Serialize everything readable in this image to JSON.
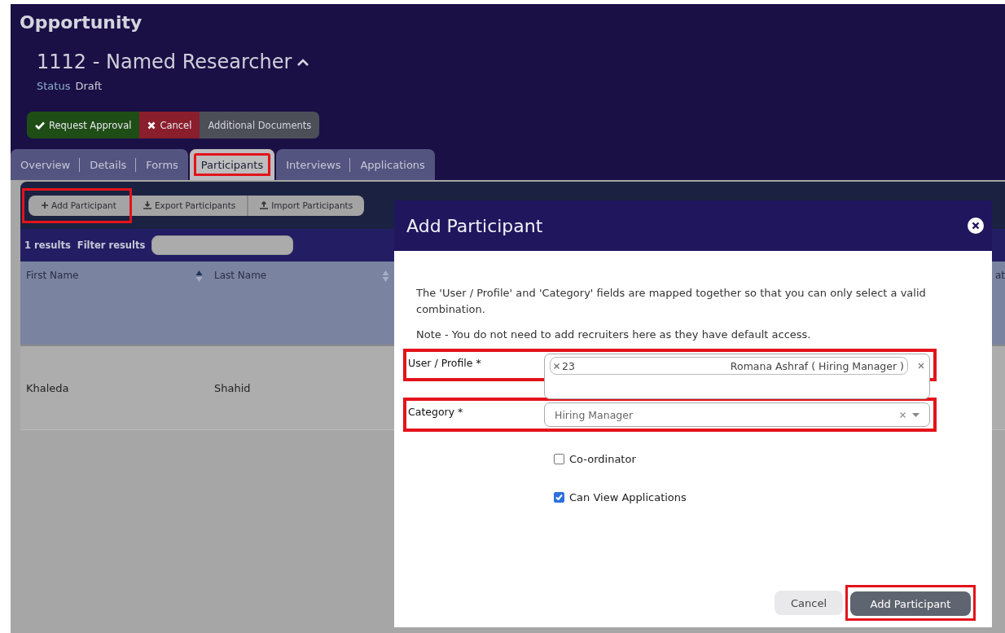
{
  "page": {
    "title": "Opportunity"
  },
  "record": {
    "title": "1112 - Named Researcher",
    "status_label": "Status",
    "status": "Draft"
  },
  "actions": [
    {
      "kind": "approve",
      "label": "Request Approval"
    },
    {
      "kind": "cancel",
      "label": "Cancel"
    },
    {
      "kind": "documents",
      "label": "Additional Documents"
    }
  ],
  "tabs": [
    {
      "label": "Overview",
      "selected": false,
      "highlighted": false
    },
    {
      "label": "Details",
      "selected": false,
      "highlighted": false
    },
    {
      "label": "Forms",
      "selected": false,
      "highlighted": false
    },
    {
      "label": "Participants",
      "selected": true,
      "highlighted": true
    },
    {
      "label": "Interviews",
      "selected": false,
      "highlighted": false
    },
    {
      "label": "Applications",
      "selected": false,
      "highlighted": false
    }
  ],
  "toolbar": [
    {
      "kind": "add",
      "label": "Add Participant",
      "highlighted": true
    },
    {
      "kind": "export",
      "label": "Export Participants",
      "highlighted": false
    },
    {
      "kind": "import",
      "label": "Import Participants",
      "highlighted": false
    }
  ],
  "filter": {
    "count": "1 results",
    "label": "Filter results"
  },
  "table": {
    "columns": [
      {
        "label": "First Name",
        "sortable": true,
        "sorted": true
      },
      {
        "label": "Last Name",
        "sortable": true,
        "sorted": false
      },
      {
        "label": "at"
      }
    ],
    "rows": [
      {
        "cells": [
          "Khaleda",
          "Shahid"
        ]
      }
    ]
  },
  "dialog": {
    "title": "Add Participant",
    "intro": "The 'User / Profile' and 'Category' fields are mapped together so that you can only select a valid combination.",
    "note": "Note - You do not need to add recruiters here as they have default access.",
    "fields": [
      {
        "kind": "tags",
        "label": "User / Profile *",
        "highlighted": true,
        "tags": [
          {
            "code": "23",
            "text": "Romana Ashraf ( Hiring Manager )"
          }
        ]
      },
      {
        "kind": "select",
        "label": "Category *",
        "highlighted": true,
        "value": "Hiring Manager"
      }
    ],
    "checkboxes": [
      {
        "label": "Co-ordinator",
        "checked": false
      },
      {
        "label": "Can View Applications",
        "checked": true
      }
    ],
    "buttons": [
      {
        "kind": "secondary",
        "label": "Cancel",
        "highlighted": false
      },
      {
        "kind": "primary",
        "label": "Add Participant",
        "highlighted": true
      }
    ]
  }
}
